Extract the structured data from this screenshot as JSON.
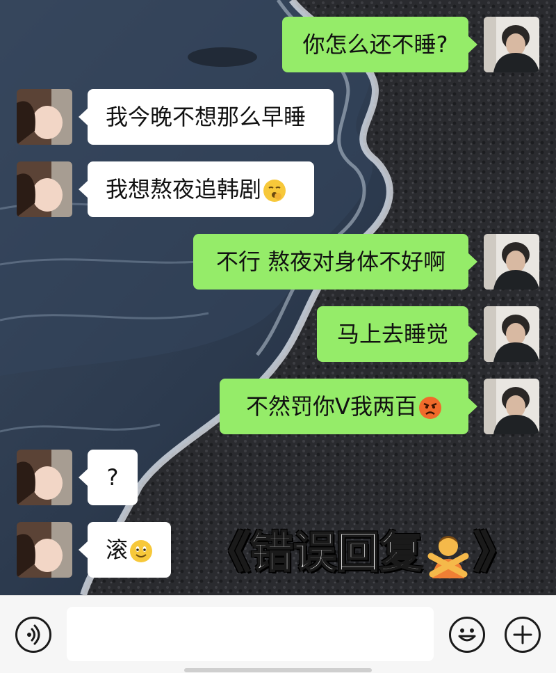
{
  "messages": [
    {
      "side": "out",
      "text": "你怎么还不睡?",
      "emoji": ""
    },
    {
      "side": "in",
      "text": "我今晚不想那么早睡",
      "emoji": ""
    },
    {
      "side": "in",
      "text": "我想熬夜追韩剧",
      "emoji": "yawning-face-emoji"
    },
    {
      "side": "out",
      "text": "不行 熬夜对身体不好啊",
      "emoji": ""
    },
    {
      "side": "out",
      "text": "马上去睡觉",
      "emoji": ""
    },
    {
      "side": "out",
      "text": "不然罚你V我两百",
      "emoji": "angry-face-emoji"
    },
    {
      "side": "in",
      "text": "?",
      "emoji": ""
    },
    {
      "side": "in",
      "text": "滚",
      "emoji": "smiling-face-emoji"
    }
  ],
  "overlay": {
    "open_bracket": "《",
    "title": "错误回复",
    "emoji": "person-gesturing-no-emoji",
    "close_bracket": "》"
  },
  "input_bar": {
    "voice_icon": "voice-icon",
    "text_value": "",
    "emoji_icon": "smiley-icon",
    "plus_icon": "plus-icon"
  },
  "colors": {
    "sent_bubble": "#95ec69",
    "received_bubble": "#ffffff",
    "input_bar_bg": "#f6f6f6"
  }
}
